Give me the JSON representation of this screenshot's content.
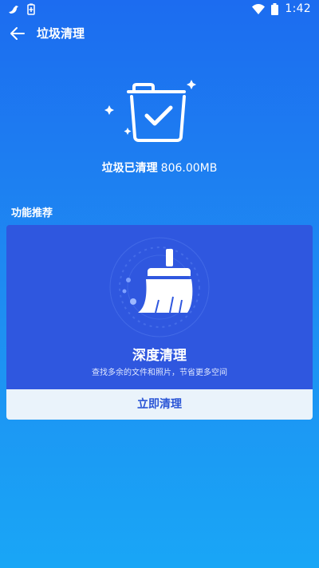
{
  "status_bar": {
    "time": "1:42",
    "icons": [
      "notification-bird-icon",
      "battery-saver-icon",
      "wifi-icon",
      "battery-icon"
    ]
  },
  "header": {
    "back_icon": "arrow-left-icon",
    "title": "垃圾清理"
  },
  "result": {
    "icon": "trash-check-icon",
    "label": "垃圾已清理",
    "size": "806.00MB"
  },
  "recommend": {
    "section_title": "功能推荐",
    "card": {
      "icon": "broom-icon",
      "title": "深度清理",
      "subtitle": "查找多余的文件和照片，节省更多空间",
      "button_label": "立即清理"
    }
  },
  "colors": {
    "background_top": "#1c6cf0",
    "background_bottom": "#19a6f6",
    "card_background": "#2f57df",
    "button_background": "#eaf3fb",
    "button_text": "#2a55d6"
  }
}
